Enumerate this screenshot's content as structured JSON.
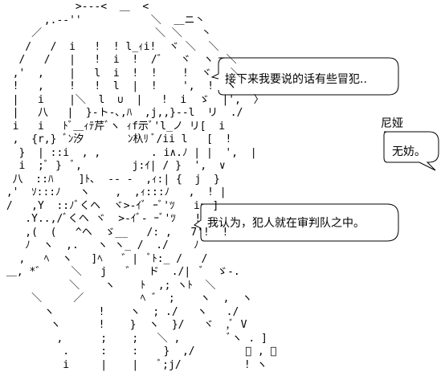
{
  "ascii_art": {
    "lines": [
      "            >--‐<  ＿  <",
      "       ,.-‐''           ＼  ＿ニ丶",
      "     ／                  ＼ ＼   丶",
      "    /   /  i   !  ! l_ｨi!  ヾ ＼  ＼",
      "   /   /   |   !  i  !  /゛  ヾ  ヽ  ＼",
      "  ,'  ,    |   l  i  !  !    !  ヾ   ＼",
      "  !   ,    !   !  l  |  !    ',  !  ヽ",
      "  |   i    |＼  l  ∪  |   !  i  ゞ  |',  〉",
      "  |   八   |  }-ト‐､,ﾊ  ,j,,}‐‐l  リ  ./",
      "  i   i   ﾄﾞ＿ｨﾃ芹ﾞヽ ｨf示ﾞ'l_ノ リ[  i",
      "  ,  {r,} ﾞﾝ汐       ﾝ杁ﾘ ﾞ/ii l   [  !",
      "   }  | ::i  , ,        . i∧.ﾉ | |  ',  |",
      "   i  ;ﾞ }  ﾞ,        j:ｲ| / }  ',  ∨",
      "  八  ::ﾊ    ]ﾄ､  ‐‐ ‐  ,ｨ:| {  j  }",
      " ,'  ｿ:::ﾉ   ヽ    ,  ,ｨ:::ﾉ   ,  ! |",
      " /   ,Y  ::ﾉﾞくヘ  ヾ>‐ｲﾞ ｰﾞ'ﾂ   i  ]",
      "    .Y..,/ﾞくヘ ヾ  >-ｲﾞ- ｰﾞ'ﾂ   !",
      "    ,(  (   ^ヘ  ゞ__   /: ,   7'!  !",
      "    ﾉ  ヽ  ,.   ヽ ヽ_ /  ./    ﾉ",
      "   ,   ﾍ  ヽ   ]ﾍ   ゛|  ﾞﾄ:_ /   /",
      " ＿, *゛    ＼   j   ゛  ド  ./|  ﾞ  ゞ‐.",
      "           ＼    ヽ    ﾄ  ,; ヽﾄ  ＼",
      "     ＼     ／         ﾍ ゛ ;    ヽ  ,  ヽ",
      "       ヽ       !    ヽ  ; ./   ヽ   ./",
      "        ヽ      !    }  ヽ  }/   ヾ  ,ﾞ V",
      "         ,      ;    ;   ＼ ,        ﾞヽ . ]",
      "          .     :    :    }  ,/        ﾞ , ﾞ",
      "          i     |    |   ﾞ;j/          ! ヽ"
    ]
  },
  "speech": [
    {
      "speaker": "",
      "text": "接下来我要说的话有些冒犯.."
    },
    {
      "speaker": "尼娅",
      "text": "无妨。"
    },
    {
      "speaker": "",
      "text": "我认为，犯人就在审判队之中。"
    }
  ]
}
